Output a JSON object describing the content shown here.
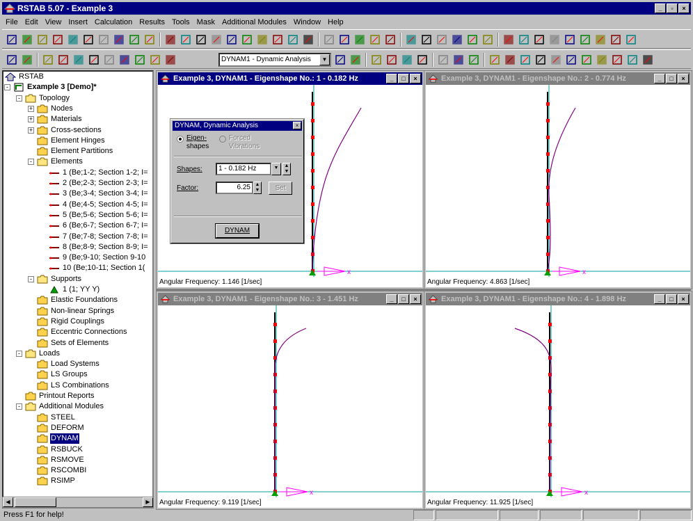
{
  "app": {
    "title": "RSTAB 5.07 - Example 3"
  },
  "menu": [
    "File",
    "Edit",
    "View",
    "Insert",
    "Calculation",
    "Results",
    "Tools",
    "Mask",
    "Additional Modules",
    "Window",
    "Help"
  ],
  "toolbar": {
    "module_combo": "DYNAM1 - Dynamic Analysis"
  },
  "tree": [
    {
      "label": "RSTAB",
      "level": 0,
      "icon": "rstab-icon",
      "x": 0
    },
    {
      "label": "Example 3 [Demo]*",
      "level": 0,
      "icon": "project-icon",
      "bold": true,
      "pm": "-"
    },
    {
      "label": "Topology",
      "level": 1,
      "icon": "folder-open-icon",
      "pm": "-"
    },
    {
      "label": "Nodes",
      "level": 2,
      "icon": "folder-icon",
      "pm": "+"
    },
    {
      "label": "Materials",
      "level": 2,
      "icon": "folder-icon",
      "pm": "+"
    },
    {
      "label": "Cross-sections",
      "level": 2,
      "icon": "folder-icon",
      "pm": "+"
    },
    {
      "label": "Element Hinges",
      "level": 2,
      "icon": "folder-icon"
    },
    {
      "label": "Element Partitions",
      "level": 2,
      "icon": "folder-icon"
    },
    {
      "label": "Elements",
      "level": 2,
      "icon": "folder-open-icon",
      "pm": "-"
    },
    {
      "label": "1 (Be;1-2; Section 1-2; I=",
      "level": 3,
      "icon": "element-icon"
    },
    {
      "label": "2 (Be;2-3; Section 2-3; I=",
      "level": 3,
      "icon": "element-icon"
    },
    {
      "label": "3 (Be;3-4; Section 3-4; I=",
      "level": 3,
      "icon": "element-icon"
    },
    {
      "label": "4 (Be;4-5; Section 4-5; I=",
      "level": 3,
      "icon": "element-icon"
    },
    {
      "label": "5 (Be;5-6; Section 5-6; I=",
      "level": 3,
      "icon": "element-icon"
    },
    {
      "label": "6 (Be;6-7; Section 6-7; I=",
      "level": 3,
      "icon": "element-icon"
    },
    {
      "label": "7 (Be;7-8; Section 7-8; I=",
      "level": 3,
      "icon": "element-icon"
    },
    {
      "label": "8 (Be;8-9; Section 8-9; I=",
      "level": 3,
      "icon": "element-icon"
    },
    {
      "label": "9 (Be;9-10; Section 9-10",
      "level": 3,
      "icon": "element-icon"
    },
    {
      "label": "10 (Be;10-11; Section 1(",
      "level": 3,
      "icon": "element-icon"
    },
    {
      "label": "Supports",
      "level": 2,
      "icon": "folder-open-icon",
      "pm": "-"
    },
    {
      "label": "1 (1; YY Y)",
      "level": 3,
      "icon": "support-icon"
    },
    {
      "label": "Elastic Foundations",
      "level": 2,
      "icon": "folder-icon"
    },
    {
      "label": "Non-linear Springs",
      "level": 2,
      "icon": "folder-icon"
    },
    {
      "label": "Rigid Couplings",
      "level": 2,
      "icon": "folder-icon"
    },
    {
      "label": "Eccentric Connections",
      "level": 2,
      "icon": "folder-icon"
    },
    {
      "label": "Sets of Elements",
      "level": 2,
      "icon": "folder-icon"
    },
    {
      "label": "Loads",
      "level": 1,
      "icon": "folder-open-icon",
      "pm": "-"
    },
    {
      "label": "Load Systems",
      "level": 2,
      "icon": "folder-icon"
    },
    {
      "label": "LS Groups",
      "level": 2,
      "icon": "folder-icon"
    },
    {
      "label": "LS Combinations",
      "level": 2,
      "icon": "folder-icon"
    },
    {
      "label": "Printout Reports",
      "level": 1,
      "icon": "folder-icon"
    },
    {
      "label": "Additional Modules",
      "level": 1,
      "icon": "folder-open-icon",
      "pm": "-"
    },
    {
      "label": "STEEL",
      "level": 2,
      "icon": "folder-icon"
    },
    {
      "label": "DEFORM",
      "level": 2,
      "icon": "folder-icon"
    },
    {
      "label": "DYNAM",
      "level": 2,
      "icon": "folder-icon",
      "selected": true
    },
    {
      "label": "RSBUCK",
      "level": 2,
      "icon": "folder-icon"
    },
    {
      "label": "RSMOVE",
      "level": 2,
      "icon": "folder-icon"
    },
    {
      "label": "RSCOMBI",
      "level": 2,
      "icon": "folder-icon"
    },
    {
      "label": "RSIMP",
      "level": 2,
      "icon": "folder-icon"
    }
  ],
  "windows": [
    {
      "title": "Example 3, DYNAM1 - Eigenshape No.: 1 - 0.182 Hz",
      "freq": "Angular Frequency: 1.146 [1/sec]",
      "active": true
    },
    {
      "title": "Example 3, DYNAM1 - Eigenshape No.: 2 - 0.774 Hz",
      "freq": "Angular Frequency: 4.863 [1/sec]",
      "active": false
    },
    {
      "title": "Example 3, DYNAM1 - Eigenshape No.: 3 - 1.451 Hz",
      "freq": "Angular Frequency: 9.119 [1/sec]",
      "active": false
    },
    {
      "title": "Example 3, DYNAM1 - Eigenshape No.: 4 - 1.898 Hz",
      "freq": "Angular Frequency: 11.925 [1/sec]",
      "active": false
    }
  ],
  "axis_label": "x",
  "dialog": {
    "title": "DYNAM, Dynamic Analysis",
    "radio1": "Eigen-",
    "radio1b": "shapes",
    "radio2": "Forced",
    "radio2b": "Vibrations",
    "shapes_label": "Shapes:",
    "shapes_value": "1 - 0.182 Hz",
    "factor_label": "Factor:",
    "factor_value": "6.25",
    "set_button": "Set",
    "dynam_button": "DYNAM"
  },
  "status": {
    "message": "Press F1 for help!"
  },
  "colors": {
    "titlebar": "#000080",
    "mode_line": "#800080",
    "node": "#ff0000",
    "axis": "#00a0a0",
    "load": "#ff00ff"
  }
}
